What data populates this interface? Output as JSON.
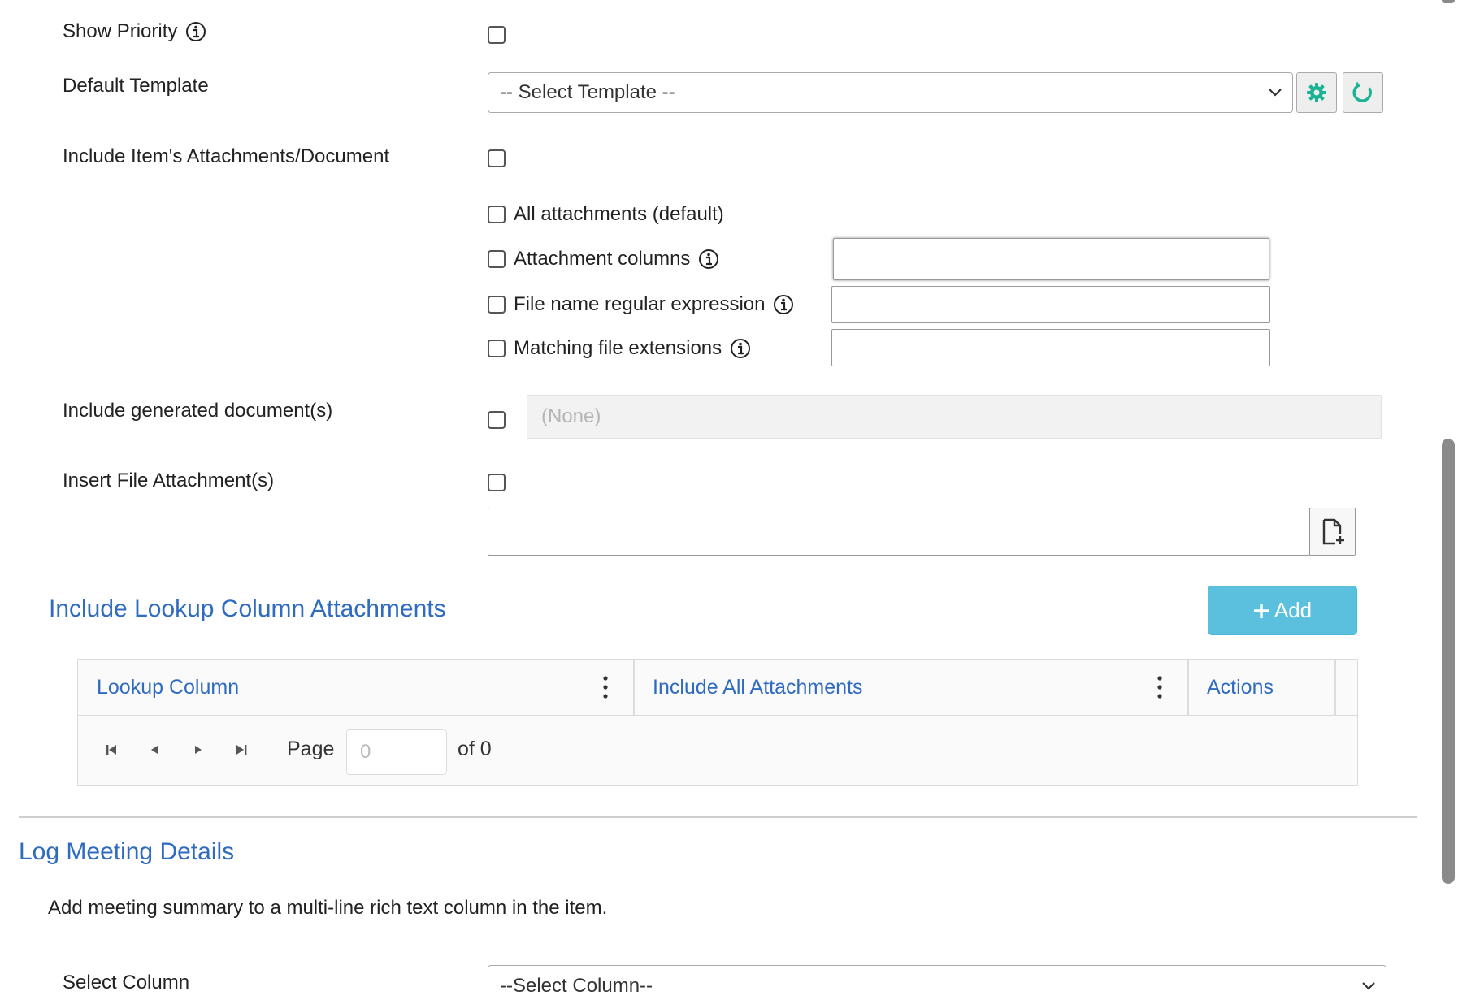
{
  "form": {
    "show_priority": {
      "label": "Show Priority",
      "checked": false
    },
    "default_template": {
      "label": "Default Template",
      "placeholder": "-- Select Template --"
    },
    "include_attachments": {
      "label": "Include Item's Attachments/Document",
      "checked": false
    },
    "attachment_options": [
      {
        "label": "All attachments (default)",
        "checked": false
      },
      {
        "label": "Attachment columns",
        "checked": false
      },
      {
        "label": "File name regular expression",
        "checked": false
      },
      {
        "label": "Matching file extensions",
        "checked": false
      }
    ],
    "include_generated": {
      "label": "Include generated document(s)",
      "checked": false,
      "value": "(None)"
    },
    "insert_file": {
      "label": "Insert File Attachment(s)",
      "checked": false
    }
  },
  "lookup_section": {
    "title": "Include Lookup Column Attachments",
    "add_label": "Add",
    "columns": [
      "Lookup Column",
      "Include All Attachments",
      "Actions"
    ],
    "pager": {
      "page_label": "Page",
      "page_value": "0",
      "of_label": "of 0"
    }
  },
  "log_meeting": {
    "title": "Log Meeting Details",
    "description": "Add meeting summary to a multi-line rich text column in the item.",
    "select_column_label": "Select Column",
    "select_column_placeholder": "--Select Column--"
  },
  "colors": {
    "accent": "#2f6bbf",
    "add_button": "#5bc0de",
    "gear_icon": "#1ab394"
  },
  "icons": [
    "info-icon",
    "chevron-down-icon",
    "gear-icon",
    "refresh-icon",
    "file-add-icon",
    "plus-icon",
    "kebab-icon",
    "first-page-icon",
    "prev-page-icon",
    "next-page-icon",
    "last-page-icon"
  ]
}
